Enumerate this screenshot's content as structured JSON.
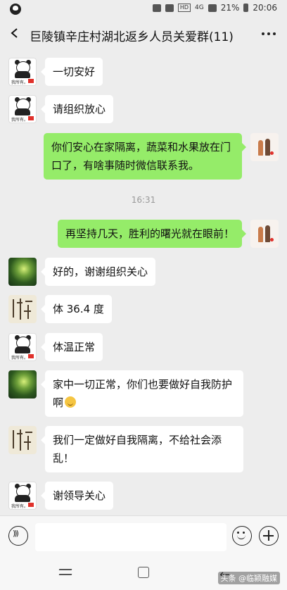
{
  "status_bar": {
    "network": "4G",
    "hd": "HD",
    "battery": "21%",
    "time": "20:06"
  },
  "header": {
    "title": "巨陵镇辛庄村湖北返乡人员关爱群(11)",
    "back_icon": "chevron-left-icon",
    "more_icon": "more-dots-icon"
  },
  "messages": [
    {
      "side": "left",
      "avatar": "panda",
      "text": "一切安好"
    },
    {
      "side": "left",
      "avatar": "panda",
      "text": "请组织放心"
    },
    {
      "side": "right",
      "avatar": "couple",
      "text": "你们安心在家隔离，蔬菜和水果放在门口了，有啥事随时微信联系我。"
    },
    {
      "timestamp": "16:31"
    },
    {
      "side": "right",
      "avatar": "couple",
      "text": "再坚持几天，胜利的曙光就在眼前！"
    },
    {
      "side": "left",
      "avatar": "forest",
      "text": "好的，谢谢组织关心"
    },
    {
      "side": "left",
      "avatar": "calligraphy",
      "text": "体 36.4 度"
    },
    {
      "side": "left",
      "avatar": "panda",
      "text": "体温正常"
    },
    {
      "side": "left",
      "avatar": "forest",
      "text": "家中一切正常，你们也要做好自我防护啊"
    },
    {
      "side": "left",
      "avatar": "calligraphy",
      "text": "我们一定做好自我隔离，不给社会添乱！"
    },
    {
      "side": "left",
      "avatar": "panda",
      "text": "谢领导关心"
    }
  ],
  "avatar_labels": {
    "panda": "我所有。"
  },
  "input_bar": {
    "voice_icon": "voice-icon",
    "emoji_icon": "emoji-icon",
    "plus_icon": "plus-icon",
    "text_value": ""
  },
  "watermark": "头条 @临颍融媒",
  "colors": {
    "background": "#ededed",
    "bubble_self": "#95ec69",
    "bubble_other": "#ffffff"
  }
}
